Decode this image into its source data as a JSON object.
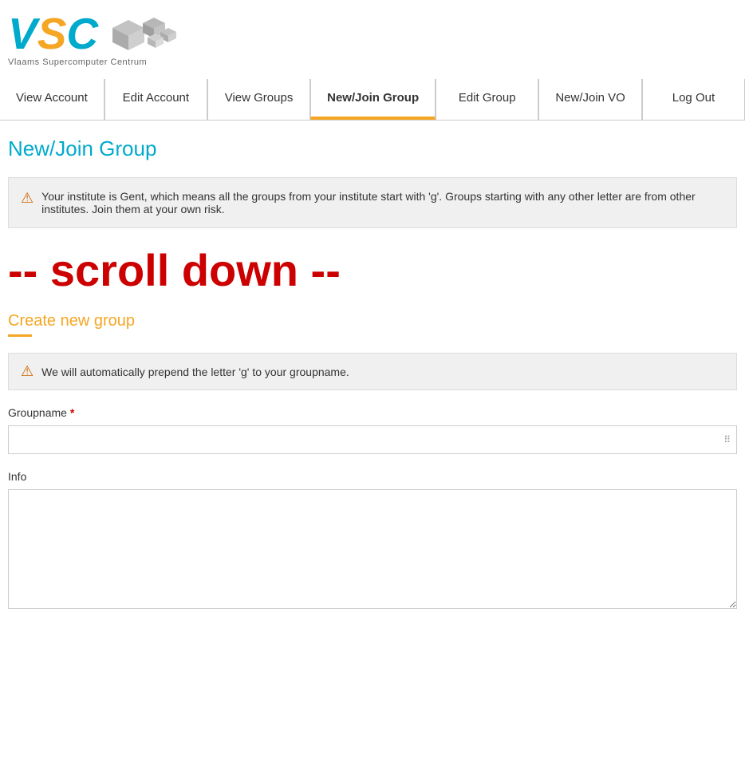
{
  "logo": {
    "letters": [
      "V",
      "S",
      "C"
    ],
    "subtitle": "Vlaams Supercomputer Centrum"
  },
  "nav": {
    "items": [
      {
        "id": "view-account",
        "label": "View Account",
        "active": false
      },
      {
        "id": "edit-account",
        "label": "Edit Account",
        "active": false
      },
      {
        "id": "view-groups",
        "label": "View Groups",
        "active": false
      },
      {
        "id": "new-join-group",
        "label": "New/Join Group",
        "active": true
      },
      {
        "id": "edit-group",
        "label": "Edit Group",
        "active": false
      },
      {
        "id": "new-join-vo",
        "label": "New/Join VO",
        "active": false
      },
      {
        "id": "log-out",
        "label": "Log Out",
        "active": false
      }
    ]
  },
  "page": {
    "title": "New/Join Group",
    "warning_text": "Your institute is Gent, which means all the groups from your institute start with 'g'. Groups starting with any other letter are from other institutes. Join them at your own risk.",
    "scroll_text": "-- scroll down --",
    "section_title": "Create new group",
    "small_warning": "We will automatically prepend the letter 'g' to your groupname.",
    "groupname_label": "Groupname",
    "groupname_required": "*",
    "info_label": "Info"
  },
  "icons": {
    "warning": "⚠",
    "grip": "⠿"
  }
}
